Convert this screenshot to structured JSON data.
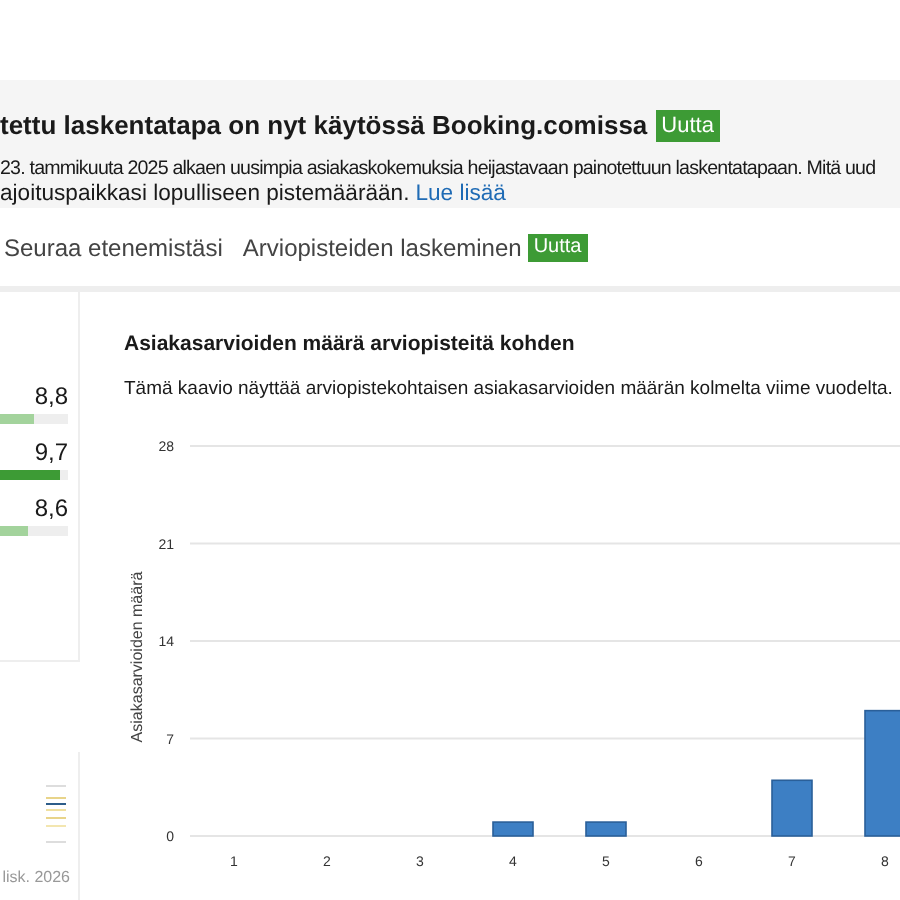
{
  "banner": {
    "title": "tettu laskentatapa on nyt käytössä Booking.comissa",
    "badge": "Uutta",
    "lines": [
      "23. tammikuuta 2025 alkaen uusimpia asiakaskokemuksia heijastavaan painotettuun laskentatapaan. Mitä uud",
      "ajoituspaikkasi lopulliseen pistemäärään."
    ],
    "link": "Lue lisää"
  },
  "tabs": [
    {
      "label": "Seuraa etenemistäsi",
      "selected": false
    },
    {
      "label": "Arviopisteiden laskeminen",
      "selected": false,
      "badge": "Uutta"
    }
  ],
  "scores": [
    {
      "value": "8,8",
      "level": 0.88,
      "color": "#a3d39c"
    },
    {
      "value": "9,7",
      "level": 0.97,
      "color": "#3d9b35"
    },
    {
      "value": "8,6",
      "level": 0.86,
      "color": "#a3d39c"
    }
  ],
  "trend_card": {
    "date": "lisk. 2026"
  },
  "chart_card": {
    "title": "Asiakasarvioiden määrä arviopisteitä kohden",
    "subtitle": "Tämä kaavio näyttää arviopistekohtaisen asiakasarvioiden määrän kolmelta viime vuodelta.",
    "chart_data": {
      "type": "bar",
      "ylabel": "Asiakasarvioiden määrä",
      "categories": [
        "1",
        "2",
        "3",
        "4",
        "5",
        "6",
        "7",
        "8"
      ],
      "grid": true,
      "series": [
        {
          "color": "#3d7fc4",
          "values": [
            0,
            0,
            0,
            1,
            1,
            0,
            4,
            9
          ]
        }
      ],
      "ylim": [
        0,
        28
      ],
      "yticks": [
        0,
        7,
        14,
        21,
        28
      ]
    }
  }
}
